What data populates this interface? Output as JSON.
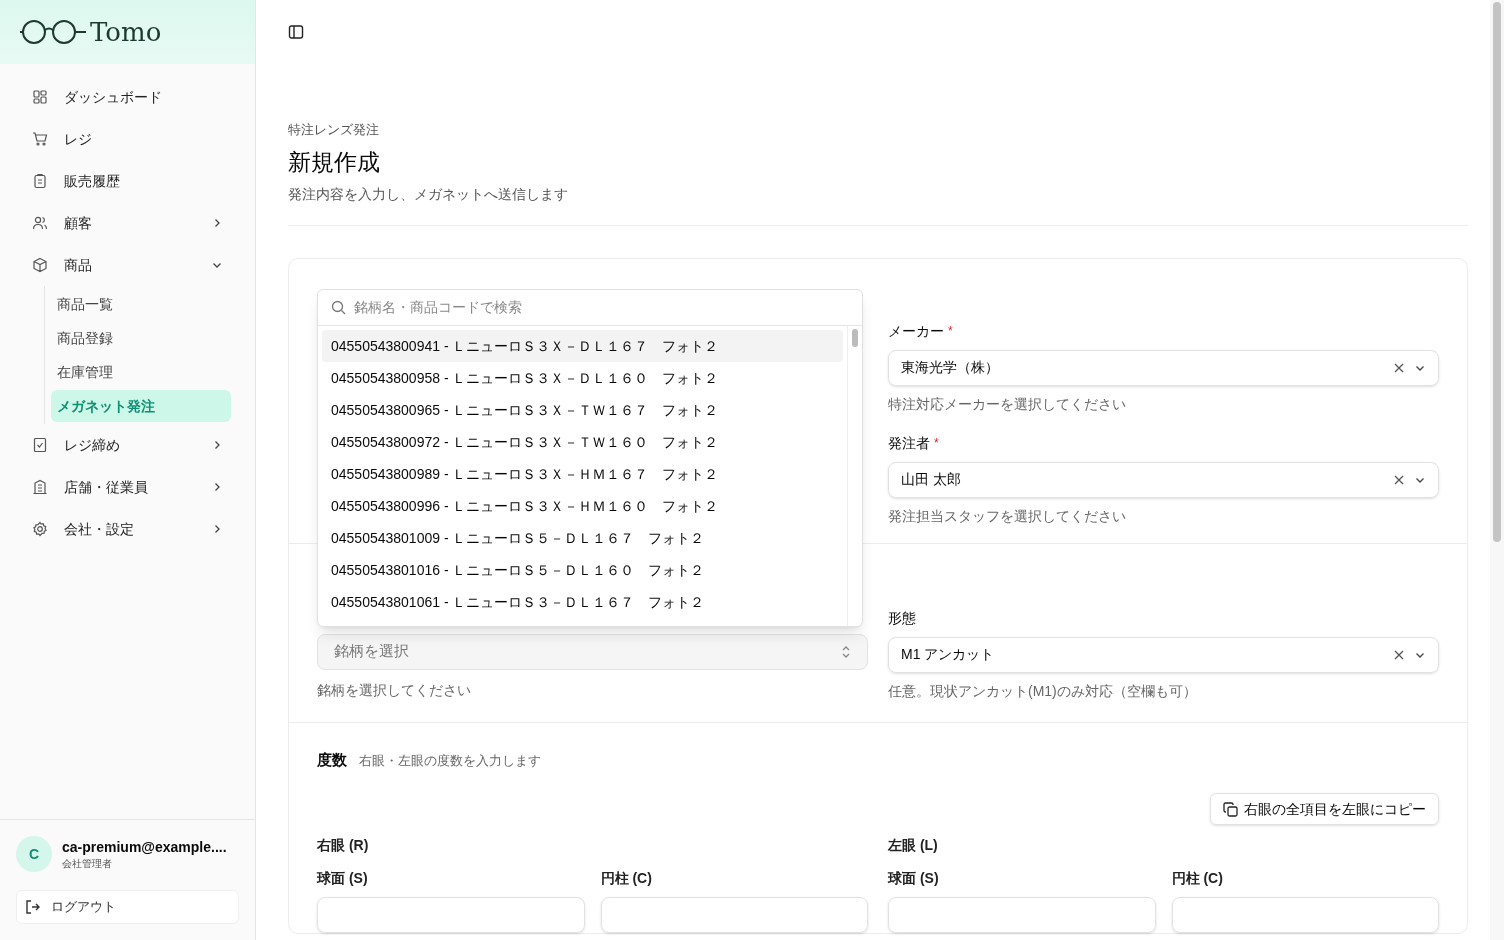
{
  "brand": "Tomo",
  "sidebar": {
    "items": [
      {
        "label": "ダッシュボード",
        "selected": false
      },
      {
        "label": "レジ",
        "selected": false
      },
      {
        "label": "販売履歴",
        "selected": false
      },
      {
        "label": "顧客",
        "selected": false,
        "expanded": false
      },
      {
        "label": "商品",
        "selected": false,
        "expanded": true,
        "children": [
          {
            "label": "商品一覧",
            "selected": false
          },
          {
            "label": "商品登録",
            "selected": false
          },
          {
            "label": "在庫管理",
            "selected": false
          },
          {
            "label": "メガネット発注",
            "selected": true
          }
        ]
      },
      {
        "label": "レジ締め",
        "selected": false,
        "expanded": false
      },
      {
        "label": "店舗・従業員",
        "selected": false,
        "expanded": false
      },
      {
        "label": "会社・設定",
        "selected": false,
        "expanded": false
      }
    ],
    "user": {
      "avatar": "C",
      "email": "ca-premium@example....",
      "role": "会社管理者"
    },
    "logout": "ログアウト"
  },
  "header": {
    "breadcrumb": "特注レンズ発注",
    "title": "新規作成",
    "subtitle": "発注内容を入力し、メガネットへ送信します"
  },
  "order_info": {
    "fields": [
      {
        "label": "メーカー",
        "required_mark": "*",
        "value": "東海光学（株）",
        "help": "特注対応メーカーを選択してください"
      },
      {
        "label": "発注者",
        "required_mark": "*",
        "value": "山田 太郎",
        "help": "発注担当スタッフを選択してください"
      }
    ]
  },
  "lens": {
    "brand_select": {
      "placeholder": "銘柄を選択",
      "help": "銘柄を選択してください"
    },
    "shape": {
      "label": "形態",
      "value": "M1 アンカット",
      "help": "任意。現状アンカット(M1)のみ対応（空欄も可）"
    }
  },
  "brand_dropdown": {
    "search_placeholder": "銘柄名・商品コードで検索",
    "options": [
      {
        "label": "04550543800941 - ＬニューロＳ３Ｘ－ＤＬ１６７　フォト２",
        "selected": true
      },
      {
        "label": "04550543800958 - ＬニューロＳ３Ｘ－ＤＬ１６０　フォト２",
        "selected": false
      },
      {
        "label": "04550543800965 - ＬニューロＳ３Ｘ－ＴＷ１６７　フォト２",
        "selected": false
      },
      {
        "label": "04550543800972 - ＬニューロＳ３Ｘ－ＴＷ１６０　フォト２",
        "selected": false
      },
      {
        "label": "04550543800989 - ＬニューロＳ３Ｘ－ＨＭ１６７　フォト２",
        "selected": false
      },
      {
        "label": "04550543800996 - ＬニューロＳ３Ｘ－ＨＭ１６０　フォト２",
        "selected": false
      },
      {
        "label": "04550543801009 - ＬニューロＳ５－ＤＬ１６７　フォト２",
        "selected": false
      },
      {
        "label": "04550543801016 - ＬニューロＳ５－ＤＬ１６０　フォト２",
        "selected": false
      },
      {
        "label": "04550543801061 - ＬニューロＳ３－ＤＬ１６７　フォト２",
        "selected": false
      }
    ]
  },
  "power": {
    "title": "度数",
    "subtitle": "右眼・左眼の度数を入力します",
    "copy_button": "右眼の全項目を左眼にコピー",
    "eyes": [
      {
        "label": "右眼 (R)",
        "fields": [
          "球面 (S)",
          "円柱 (C)"
        ]
      },
      {
        "label": "左眼 (L)",
        "fields": [
          "球面 (S)",
          "円柱 (C)"
        ]
      }
    ]
  }
}
